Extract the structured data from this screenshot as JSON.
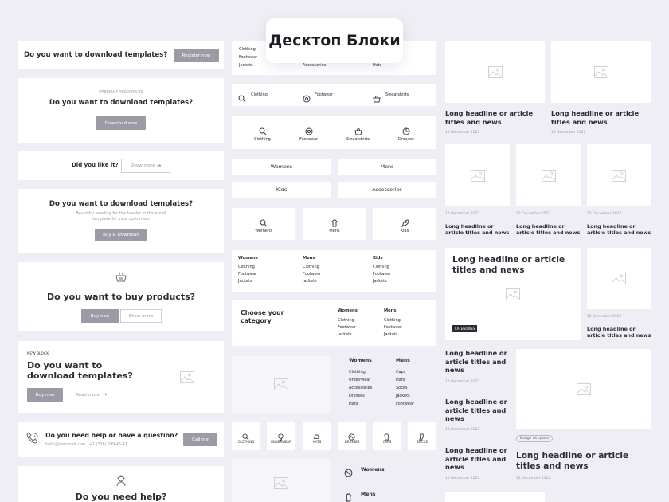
{
  "page_title": "Десктоп Блоки",
  "left": {
    "banner1": {
      "title": "Do you want to download templates?",
      "button": "Register now"
    },
    "banner2": {
      "eyebrow": "PREMIUM RESOURCES",
      "title": "Do you want to download templates?",
      "button": "Download now"
    },
    "banner3": {
      "title": "Did you like it?",
      "button": "Show more",
      "arrow": "→"
    },
    "banner4": {
      "title": "Do you want to download templates?",
      "subtitle_1": "Beautiful heading for the header in the email",
      "subtitle_2": "template for your customers",
      "button": "Buy & Download"
    },
    "banner5": {
      "title": "Do you want to buy products?",
      "button_primary": "Buy now",
      "button_secondary": "Show more"
    },
    "banner6": {
      "eyebrow": "NEW BLOCK",
      "title_1": "Do you want to",
      "title_2": "download templates?",
      "button": "Buy now",
      "link": "Read more",
      "arrow": "→"
    },
    "banner7": {
      "title": "Do you need help or have a question?",
      "email": "hello@townmail.com",
      "phone": "+1 (326) 699-46-47",
      "button": "Call me"
    },
    "banner8": {
      "title": "Do you need help?"
    }
  },
  "middle": {
    "top_list": {
      "col1": [
        "Clothing",
        "Footwear",
        "Jackets"
      ],
      "col2": "Accessories",
      "col3": "Hats"
    },
    "icon_row": [
      "Clothing",
      "Footwear",
      "Sweatshirts"
    ],
    "icon_tiles": [
      "Clothing",
      "Footwear",
      "Sweatshirts",
      "Dresses"
    ],
    "cat_buttons": [
      "Womens",
      "Mens",
      "Kids",
      "Accessories"
    ],
    "big_tiles": [
      "Womens",
      "Mens",
      "Kids"
    ],
    "lists": [
      {
        "title": "Womens",
        "items": [
          "Clothing",
          "Footwear",
          "Jackets"
        ]
      },
      {
        "title": "Mens",
        "items": [
          "Clothing",
          "Footwear",
          "Jackets"
        ]
      },
      {
        "title": "Kids",
        "items": [
          "Clothing",
          "Footwear",
          "Jackets"
        ]
      }
    ],
    "choose": {
      "title_1": "Choose your",
      "title_2": "category",
      "lists": [
        {
          "title": "Womens",
          "items": [
            "Clothing",
            "Footwear",
            "Jackets"
          ]
        },
        {
          "title": "Mens",
          "items": [
            "Clothing",
            "Footwear",
            "Jackets"
          ]
        }
      ]
    },
    "image_lists": [
      {
        "title": "Womens",
        "items": [
          "Clothing",
          "Underwear",
          "Accessories",
          "Dresses",
          "Hats"
        ]
      },
      {
        "title": "Mens",
        "items": [
          "Caps",
          "Hats",
          "Socks",
          "Jackets",
          "Footwear"
        ]
      }
    ],
    "small_tiles": [
      "CLOTHING",
      "UNDERWEAR",
      "HATS",
      "DRESSES",
      "CAPS",
      "SOCKS"
    ],
    "side_list": [
      "Womens",
      "Mens"
    ]
  },
  "right": {
    "headline": "Long headline or article titles and news",
    "headline_3line_1": "Long headline or",
    "headline_3line_2": "article titles and",
    "headline_3line_3": "news",
    "headline_2line_1": "Long headline or article",
    "headline_2line_2": "titles and news",
    "date": "12 December 2022",
    "categories_badge": "CATEGORIES",
    "badge_template": "Badge template",
    "big_headline_1": "Long headline or article",
    "big_headline_2": "titles and news"
  }
}
